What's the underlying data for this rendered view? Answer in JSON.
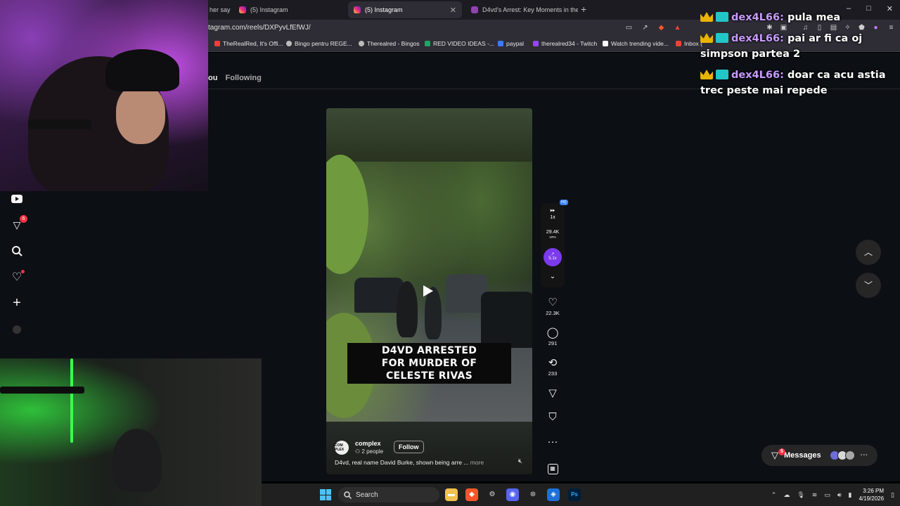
{
  "browser": {
    "tabs": [
      {
        "label": "her say"
      },
      {
        "label": "(5) Instagram"
      },
      {
        "label": "(5) Instagram"
      },
      {
        "label": "D4vd's Arrest: Key Moments in the In"
      }
    ],
    "new_tab": "+",
    "url": "tagram.com/reels/DXPyvLfEfWJ/",
    "bookmarks": [
      {
        "label": "TheRealRed, It's Offi...",
        "color": "#ff3b3b"
      },
      {
        "label": "Bingo pentru REGE...",
        "color": "#bbbbbb"
      },
      {
        "label": "Therealred - Bingos",
        "color": "#bbbbbb"
      },
      {
        "label": "RED VIDEO IDEAS -...",
        "color": "#1fa463"
      },
      {
        "label": "paypal",
        "color": "#3b7bff"
      },
      {
        "label": "therealred34 - Twitch",
        "color": "#9146ff"
      },
      {
        "label": "Watch trending vide...",
        "color": "#ffffff"
      },
      {
        "label": "Inbox (",
        "color": "#ea4335"
      }
    ],
    "window_controls": [
      "–",
      "□",
      "✕"
    ]
  },
  "instagram": {
    "feed_tabs": {
      "you": "ou",
      "following": "Following"
    },
    "reel": {
      "caption_lines": [
        "D4VD ARRESTED",
        "FOR MURDER OF",
        "CELESTE RIVAS"
      ],
      "avatar_text": "COM PLEX",
      "author": "complex",
      "people": "2 people",
      "follow": "Follow",
      "description": "D4vd, real name David Burke, shown being arre ...",
      "more": "more"
    },
    "extension": {
      "speed": "1x",
      "vph": "29.4K",
      "vph_label": "VPH",
      "boost": "5.1x",
      "hq": "HQ"
    },
    "actions": {
      "likes": "22.3K",
      "comments": "291",
      "reposts": "233"
    },
    "sidebar_badge": "6",
    "messages": {
      "label": "Messages",
      "badge": "5"
    }
  },
  "taskbar": {
    "search": "Search",
    "time": "3:26 PM",
    "date": "4/19/2026"
  },
  "chat": [
    {
      "user": "dex4L66:",
      "text": "pula mea"
    },
    {
      "user": "dex4L66:",
      "text": "pai ar fi ca oj simpson partea 2"
    },
    {
      "user": "dex4L66:",
      "text": "doar ca acu astia trec peste mai repede"
    }
  ]
}
